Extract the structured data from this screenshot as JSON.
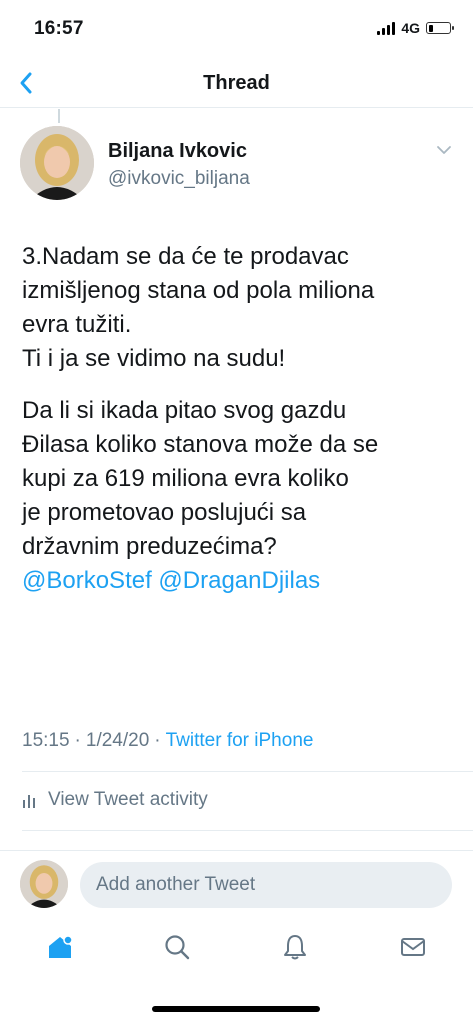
{
  "status_bar": {
    "time": "16:57",
    "network": "4G",
    "battery_level": 0.2
  },
  "nav": {
    "title": "Thread",
    "back_icon": "chevron-left-icon"
  },
  "tweet": {
    "author": {
      "name": "Biljana Ivkovic",
      "handle": "@ivkovic_biljana"
    },
    "lines": [
      "3.Nadam se da će te  prodavac",
      "izmišljenog stana od pola miliona",
      "evra tužiti.",
      "Ti i ja se vidimo na sudu!"
    ],
    "lines2": [
      "Da li si ikada pitao svog gazdu",
      "Đilasa koliko stanova može da se",
      "kupi za 619 miliona evra koliko",
      "je prometovao poslujući sa",
      "državnim preduzećima?"
    ],
    "mentions": [
      "@BorkoStef",
      "@DraganDjilas"
    ],
    "time": "15:15",
    "date": "1/24/20",
    "source": "Twitter for iPhone"
  },
  "activity": {
    "label": "View Tweet activity"
  },
  "reply": {
    "placeholder": "Add another Tweet"
  },
  "tabbar": {
    "icons": [
      "home-icon",
      "search-icon",
      "notifications-icon",
      "messages-icon"
    ]
  },
  "colors": {
    "accent": "#1da1f2",
    "secondary_text": "#657786",
    "divider": "#e6ecf0"
  }
}
